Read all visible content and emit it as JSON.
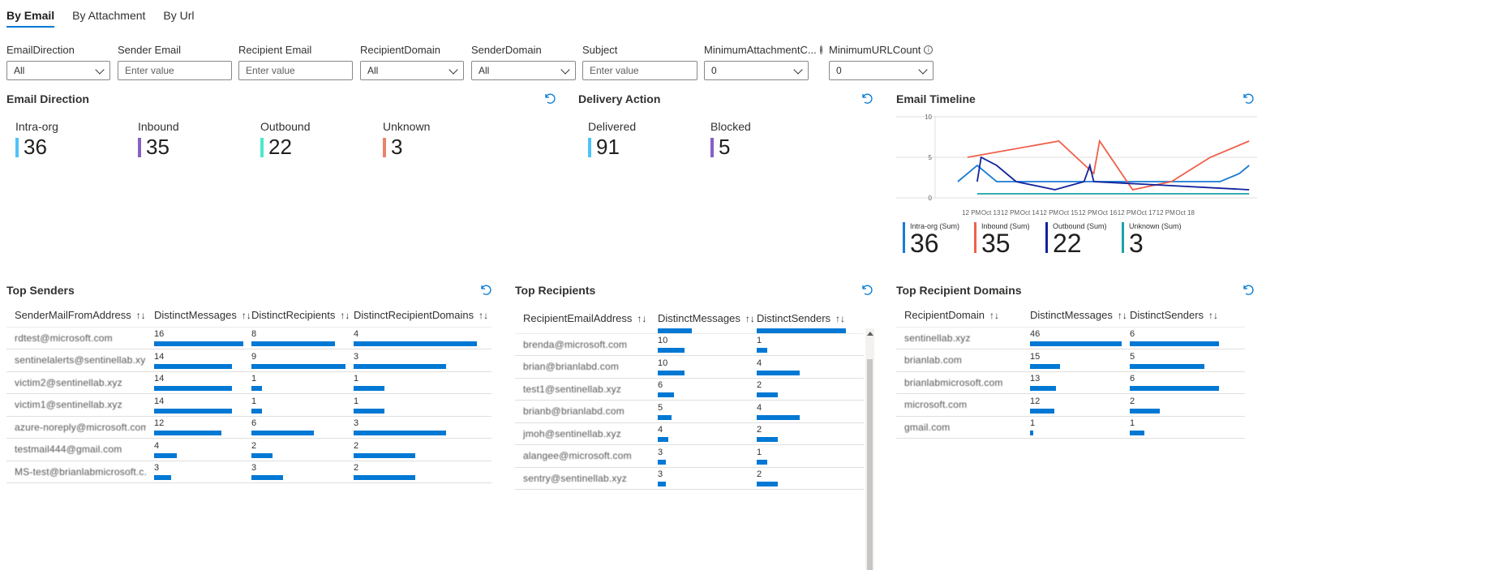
{
  "tabs": [
    "By Email",
    "By Attachment",
    "By Url"
  ],
  "filters": [
    {
      "label": "EmailDirection",
      "value": "All",
      "kind": "select"
    },
    {
      "label": "Sender Email",
      "value": "Enter value",
      "kind": "input"
    },
    {
      "label": "Recipient Email",
      "value": "Enter value",
      "kind": "input"
    },
    {
      "label": "RecipientDomain",
      "value": "All",
      "kind": "select"
    },
    {
      "label": "SenderDomain",
      "value": "All",
      "kind": "select"
    },
    {
      "label": "Subject",
      "value": "Enter value",
      "kind": "input"
    },
    {
      "label": "MinimumAttachmentC...",
      "value": "0",
      "kind": "select",
      "info": true
    },
    {
      "label": "MinimumURLCount",
      "value": "0",
      "kind": "select",
      "info": true
    }
  ],
  "email_direction": {
    "title": "Email Direction",
    "tiles": [
      {
        "label": "Intra-org",
        "value": "36",
        "color": "#4fc3f7"
      },
      {
        "label": "Inbound",
        "value": "35",
        "color": "#8661c5"
      },
      {
        "label": "Outbound",
        "value": "22",
        "color": "#4ce8c8"
      },
      {
        "label": "Unknown",
        "value": "3",
        "color": "#e8846a"
      }
    ]
  },
  "delivery_action": {
    "title": "Delivery Action",
    "tiles": [
      {
        "label": "Delivered",
        "value": "91",
        "color": "#4fc3f7"
      },
      {
        "label": "Blocked",
        "value": "5",
        "color": "#8661c5"
      }
    ]
  },
  "email_timeline": {
    "title": "Email Timeline",
    "legend": [
      {
        "label": "Intra-org (Sum)",
        "value": "36",
        "color": "#1a7ad4"
      },
      {
        "label": "Inbound (Sum)",
        "value": "35",
        "color": "#f0604a"
      },
      {
        "label": "Outbound (Sum)",
        "value": "22",
        "color": "#10239e"
      },
      {
        "label": "Unknown (Sum)",
        "value": "3",
        "color": "#1aa2a6"
      }
    ]
  },
  "chart_data": {
    "type": "line",
    "title": "Email Timeline",
    "x_ticks": [
      "12 PM",
      "Oct 13",
      "12 PM",
      "Oct 14",
      "12 PM",
      "Oct 15",
      "12 PM",
      "Oct 16",
      "12 PM",
      "Oct 17",
      "12 PM",
      "Oct 18"
    ],
    "ylim": [
      0,
      10
    ],
    "y_ticks": [
      "0",
      "5",
      "10"
    ],
    "grid": true,
    "series": [
      {
        "name": "Intra-org (Sum)",
        "color": "#1a7ad4",
        "x": [
          0,
          1,
          2,
          4,
          6,
          8,
          10,
          12,
          13.5,
          14.5,
          15
        ],
        "y": [
          2,
          4,
          2,
          2,
          2,
          2,
          2,
          2,
          2,
          3,
          4
        ]
      },
      {
        "name": "Inbound (Sum)",
        "color": "#f0604a",
        "x": [
          0.5,
          5.2,
          7,
          7.3,
          9,
          11,
          13,
          15
        ],
        "y": [
          5,
          7,
          3,
          7,
          1,
          2,
          5,
          7
        ]
      },
      {
        "name": "Outbound (Sum)",
        "color": "#10239e",
        "x": [
          1,
          1.2,
          2,
          3,
          5,
          6.5,
          6.8,
          7,
          15
        ],
        "y": [
          2,
          5,
          4,
          2,
          1,
          2,
          4,
          2,
          1
        ]
      },
      {
        "name": "Unknown (Sum)",
        "color": "#1aa2a6",
        "x": [
          1,
          15
        ],
        "y": [
          0.5,
          0.5
        ]
      }
    ]
  },
  "top_senders": {
    "title": "Top Senders",
    "columns": [
      "SenderMailFromAddress",
      "DistinctMessages",
      "DistinctRecipients",
      "DistinctRecipientDomains"
    ],
    "rows": [
      {
        "name": "rdtest@microsoft.com",
        "a": "16",
        "b": "8",
        "c": "4"
      },
      {
        "name": "sentinelalerts@sentinellab.xyz",
        "a": "14",
        "b": "9",
        "c": "3"
      },
      {
        "name": "victim2@sentinellab.xyz",
        "a": "14",
        "b": "1",
        "c": "1"
      },
      {
        "name": "victim1@sentinellab.xyz",
        "a": "14",
        "b": "1",
        "c": "1"
      },
      {
        "name": "azure-noreply@microsoft.com",
        "a": "12",
        "b": "6",
        "c": "3"
      },
      {
        "name": "testmail444@gmail.com",
        "a": "4",
        "b": "2",
        "c": "2"
      },
      {
        "name": "MS-test@brianlabmicrosoft.c...",
        "a": "3",
        "b": "3",
        "c": "2"
      }
    ],
    "max": [
      16,
      9,
      4
    ]
  },
  "top_recipients": {
    "title": "Top Recipients",
    "columns": [
      "RecipientEmailAddress",
      "DistinctMessages",
      "DistinctSenders"
    ],
    "rows": [
      {
        "name": "brenda@microsoft.com",
        "a": "10",
        "b": "1"
      },
      {
        "name": "brian@brianlabd.com",
        "a": "10",
        "b": "4"
      },
      {
        "name": "test1@sentinellab.xyz",
        "a": "6",
        "b": "2"
      },
      {
        "name": "brianb@brianlabd.com",
        "a": "5",
        "b": "4"
      },
      {
        "name": "jmoh@sentinellab.xyz",
        "a": "4",
        "b": "2"
      },
      {
        "name": "alangee@microsoft.com",
        "a": "3",
        "b": "1"
      },
      {
        "name": "sentry@sentinellab.xyz",
        "a": "3",
        "b": "2"
      }
    ],
    "max": [
      18,
      5
    ]
  },
  "top_recipient_domains": {
    "title": "Top Recipient Domains",
    "columns": [
      "RecipientDomain",
      "DistinctMessages",
      "DistinctSenders"
    ],
    "rows": [
      {
        "name": "sentinellab.xyz",
        "a": "46",
        "b": "6"
      },
      {
        "name": "brianlab.com",
        "a": "15",
        "b": "5"
      },
      {
        "name": "brianlabmicrosoft.com",
        "a": "13",
        "b": "6"
      },
      {
        "name": "microsoft.com",
        "a": "12",
        "b": "2"
      },
      {
        "name": "gmail.com",
        "a": "1",
        "b": "1"
      }
    ],
    "max": [
      46,
      6
    ]
  }
}
